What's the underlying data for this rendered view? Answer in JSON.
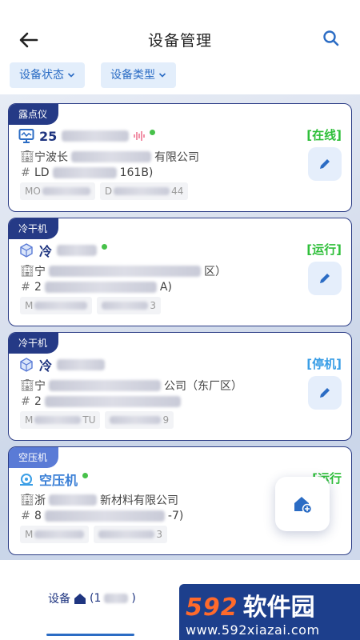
{
  "header": {
    "title": "设备管理",
    "filters": [
      "设备状态",
      "设备类型"
    ]
  },
  "devices": [
    {
      "tag": "露点仪",
      "name": "25",
      "status": "[在线]",
      "status_color": "#2fbf3a",
      "company": "宁波长",
      "company_tail": "有限公司",
      "code": "LD",
      "code_tail": "161B)",
      "chip1": "MO",
      "chip2_prefix": "D",
      "chip2_tail": "44"
    },
    {
      "tag": "冷干机",
      "name": "冷",
      "status": "[运行]",
      "status_color": "#2fbf3a",
      "company": "宁",
      "company_tail": "区）",
      "code": "2",
      "code_tail": "A)",
      "chip1": "M",
      "chip2_prefix": "",
      "chip2_tail": "3"
    },
    {
      "tag": "冷干机",
      "name": "冷",
      "status": "[停机]",
      "status_color": "#3a9ee6",
      "company": "宁",
      "company_tail": "公司（东厂区）",
      "code": "2",
      "code_tail": "",
      "chip1": "M",
      "chip1_tail": "TU",
      "chip2_prefix": "",
      "chip2_tail": "9"
    },
    {
      "tag": "空压机",
      "name": "空压机",
      "status": "[运行",
      "status_color": "#2fbf3a",
      "company": "浙",
      "company_tail": "新材料有限公司",
      "code": "8",
      "code_tail": "-7)",
      "chip1": "M",
      "chip2_prefix": "",
      "chip2_tail": "3"
    }
  ],
  "bottom_nav": {
    "tab_label": "设备",
    "tab_count_prefix": "(1",
    "tab_count_suffix": ")"
  },
  "watermark": {
    "number": "592",
    "text": "软件园",
    "url": "www.592xiazai.com"
  },
  "colors": {
    "accent": "#2b6cc4",
    "card_border": "#2c3d86",
    "tag_bg": "#253a86"
  }
}
